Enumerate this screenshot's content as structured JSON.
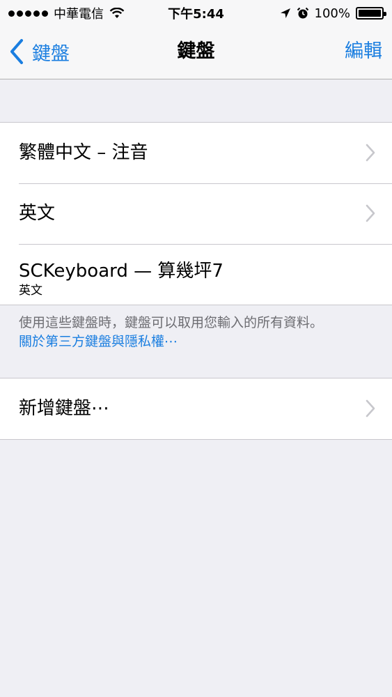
{
  "status_bar": {
    "carrier": "中華電信",
    "time": "下午5:44",
    "battery": "100%",
    "signal_icon": "signal-dots-icon",
    "wifi_icon": "wifi-icon",
    "location_icon": "location-arrow-icon",
    "alarm_icon": "alarm-clock-icon"
  },
  "nav": {
    "back_label": "鍵盤",
    "title": "鍵盤",
    "edit_label": "編輯"
  },
  "keyboards": [
    {
      "label": "繁體中文 – 注音"
    },
    {
      "label": "英文"
    },
    {
      "title": "SCKeyboard — 算幾坪7",
      "subtitle": "英文"
    }
  ],
  "footer": {
    "note": "使用這些鍵盤時，鍵盤可以取用您輸入的所有資料。",
    "link": "關於第三方鍵盤與隱私權⋯"
  },
  "add_keyboard": {
    "label": "新增鍵盤⋯"
  },
  "colors": {
    "accent": "#1a7ee0",
    "background": "#efeff4",
    "footer_text": "#6d6d72"
  }
}
